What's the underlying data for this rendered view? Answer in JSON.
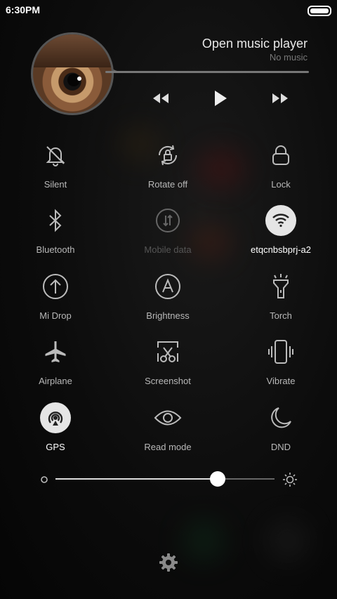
{
  "status_bar": {
    "time": "6:30PM"
  },
  "music": {
    "title": "Open music player",
    "subtitle": "No music"
  },
  "toggles": [
    {
      "label": "Silent",
      "icon": "bell-off-icon",
      "active": false
    },
    {
      "label": "Rotate off",
      "icon": "rotate-lock-icon",
      "active": false
    },
    {
      "label": "Lock",
      "icon": "lock-icon",
      "active": false
    },
    {
      "label": "Bluetooth",
      "icon": "bluetooth-icon",
      "active": false
    },
    {
      "label": "Mobile data",
      "icon": "mobile-data-icon",
      "active": false,
      "disabled": true
    },
    {
      "label": "etqcnbsbprj-a2",
      "icon": "wifi-icon",
      "active": true
    },
    {
      "label": "Mi Drop",
      "icon": "mi-drop-icon",
      "active": false
    },
    {
      "label": "Brightness",
      "icon": "auto-brightness-icon",
      "active": false
    },
    {
      "label": "Torch",
      "icon": "torch-icon",
      "active": false
    },
    {
      "label": "Airplane",
      "icon": "airplane-icon",
      "active": false
    },
    {
      "label": "Screenshot",
      "icon": "screenshot-icon",
      "active": false
    },
    {
      "label": "Vibrate",
      "icon": "vibrate-icon",
      "active": false
    },
    {
      "label": "GPS",
      "icon": "gps-icon",
      "active": true
    },
    {
      "label": "Read mode",
      "icon": "eye-icon",
      "active": false
    },
    {
      "label": "DND",
      "icon": "moon-icon",
      "active": false
    }
  ],
  "brightness": {
    "level_fraction": 0.74
  },
  "colors": {
    "active_circle": "#e5e5e5",
    "background": "#0c0c0c"
  }
}
